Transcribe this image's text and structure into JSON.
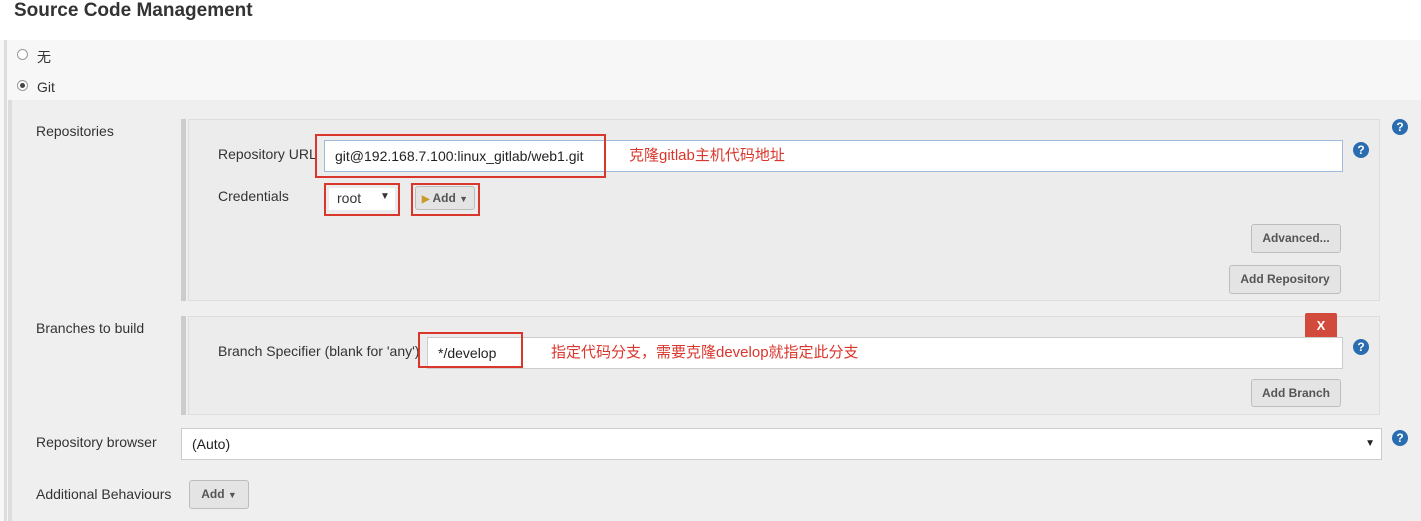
{
  "section_title": "Source Code Management",
  "scm_options": [
    {
      "label": "无",
      "selected": false
    },
    {
      "label": "Git",
      "selected": true
    }
  ],
  "repositories": {
    "label": "Repositories",
    "url_label": "Repository URL",
    "url_value": "git@192.168.7.100:linux_gitlab/web1.git",
    "url_note": "克隆gitlab主机代码地址",
    "credentials_label": "Credentials",
    "credentials_value": "root",
    "add_label": "Add",
    "advanced_label": "Advanced...",
    "add_repository_label": "Add Repository"
  },
  "branches": {
    "label": "Branches to build",
    "specifier_label": "Branch Specifier (blank for 'any')",
    "specifier_value": "*/develop",
    "note": "指定代码分支，需要克隆develop就指定此分支",
    "delete_label": "X",
    "add_branch_label": "Add Branch"
  },
  "repo_browser": {
    "label": "Repository browser",
    "value": "(Auto)"
  },
  "additional": {
    "label": "Additional Behaviours",
    "add_label": "Add"
  },
  "help_symbol": "?",
  "colors": {
    "annotation": "#d9362c",
    "help": "#2a6cb0",
    "delete": "#d24a3b"
  }
}
